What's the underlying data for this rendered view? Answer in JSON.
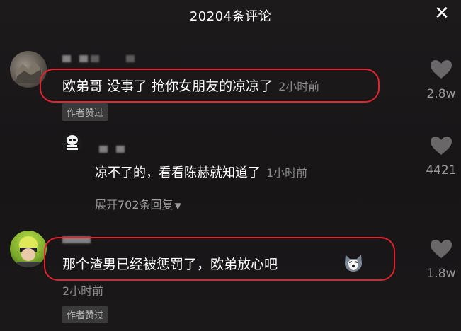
{
  "header": {
    "title": "20204条评论",
    "close_icon": "close-icon"
  },
  "comments": [
    {
      "text": "欧弟哥 没事了 抢你女朋友的凉凉了",
      "time": "2小时前",
      "badge": "作者赞过",
      "likes": "2.8w"
    },
    {
      "text": "凉不了的，看看陈赫就知道了",
      "time": "1小时前",
      "likes": "4421",
      "expand": "展开702条回复"
    },
    {
      "text": "那个渣男已经被惩罚了，欧弟放心吧",
      "time": "2小时前",
      "badge": "作者赞过",
      "likes": "1.8w",
      "emoji": "husky-emoji"
    }
  ],
  "colors": {
    "highlight": "#e3222e",
    "badge_bg": "#3b3a3b"
  }
}
